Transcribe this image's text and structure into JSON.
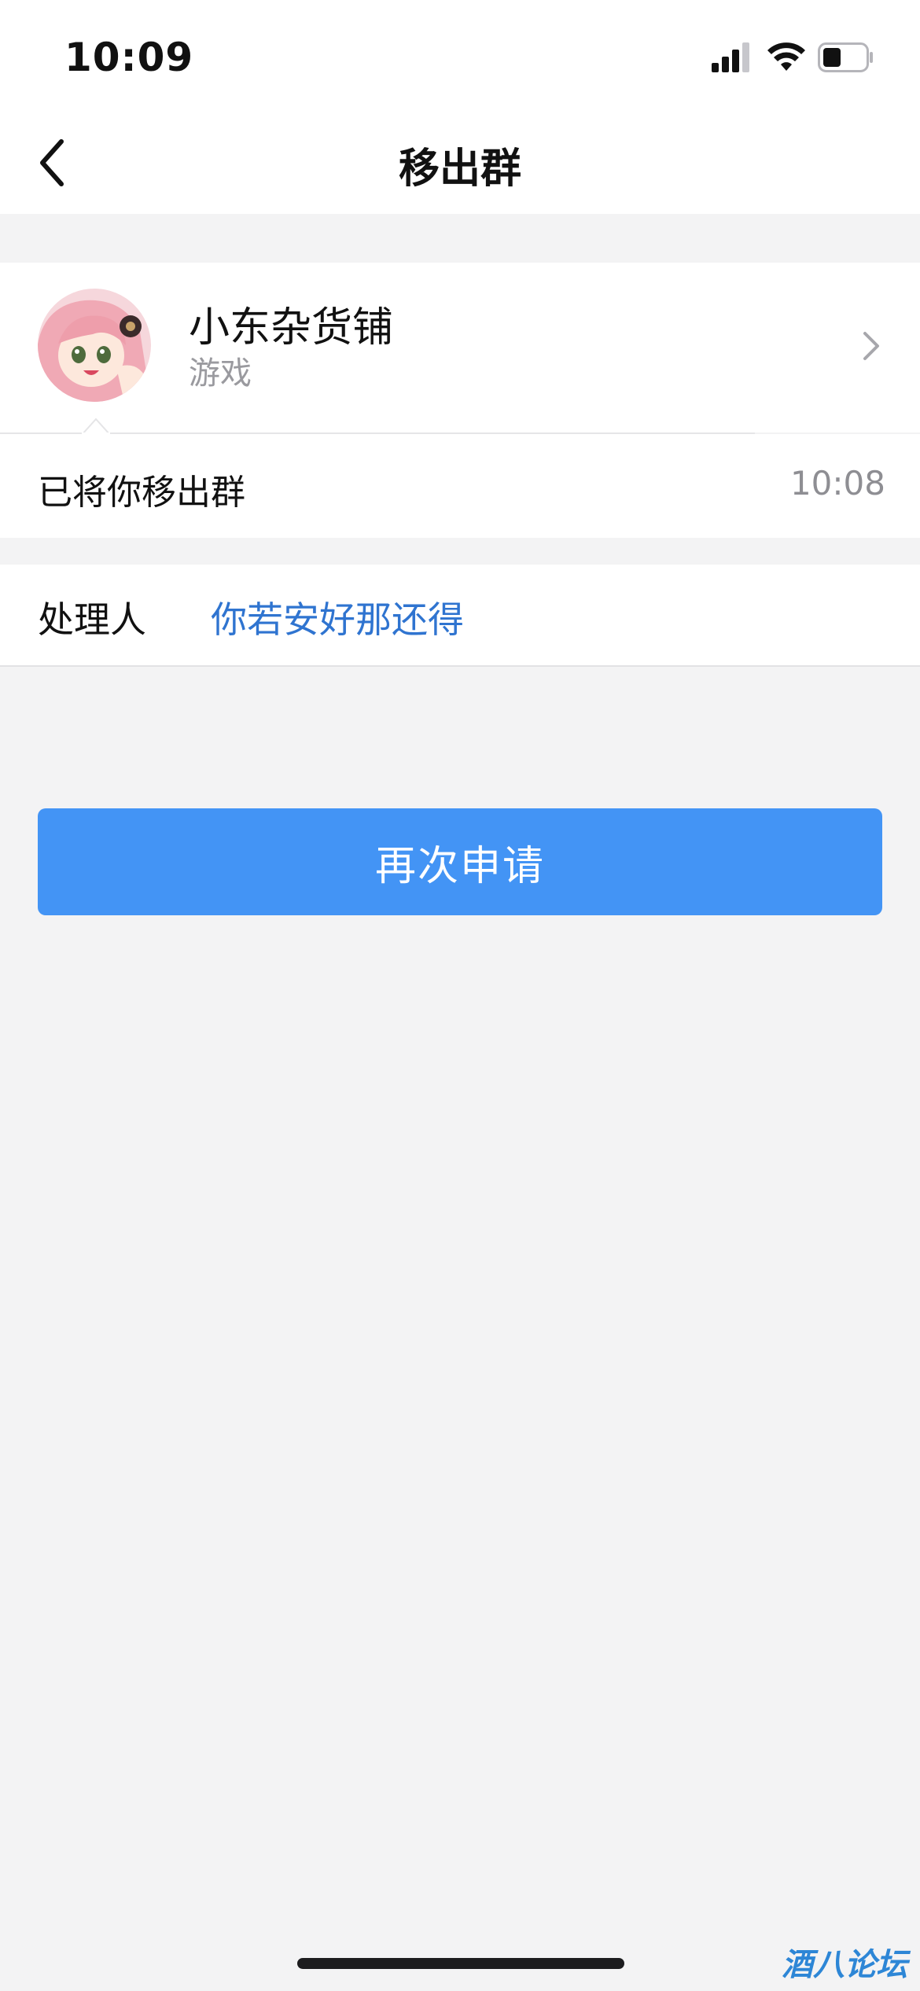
{
  "status_bar": {
    "time": "10:09",
    "icons": [
      "cellular-signal-icon",
      "wifi-icon",
      "battery-icon"
    ]
  },
  "nav": {
    "title": "移出群",
    "back_icon": "chevron-left-icon"
  },
  "group": {
    "name": "小东杂货铺",
    "tag": "游戏",
    "avatar": "anime-girl-avatar",
    "chevron_icon": "chevron-right-icon"
  },
  "notice": {
    "text": "已将你移出群",
    "time": "10:08"
  },
  "handler": {
    "label": "处理人",
    "name": "你若安好那还得"
  },
  "actions": {
    "reapply_label": "再次申请"
  },
  "watermark": "酒八论坛",
  "colors": {
    "accent": "#4394f5",
    "link": "#2f74d0",
    "background": "#f3f3f4"
  }
}
